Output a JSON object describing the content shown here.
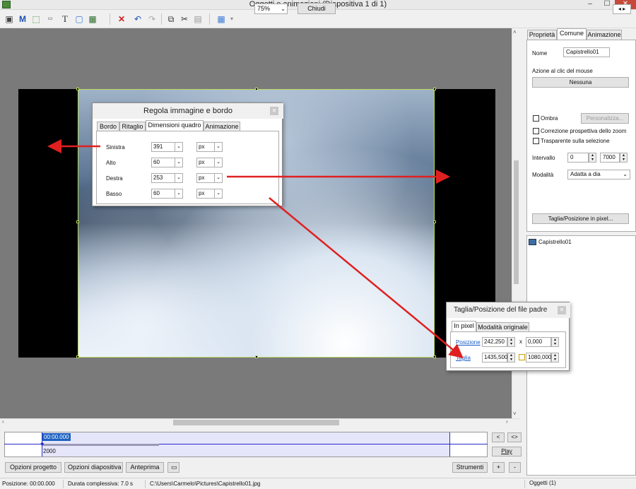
{
  "window": {
    "title": "Oggetti e animazioni  (Diapositiva 1 di 1)",
    "min": "–",
    "max": "☐",
    "close": "✕"
  },
  "toolbar": {
    "zoom": "75%",
    "close_label": "Chiudi",
    "text_tool": "T",
    "m_tool": "M"
  },
  "timeline": {
    "time": "00:00.000",
    "frame": "2000",
    "nav_left": "<",
    "nav_both": "<>",
    "play": "Play",
    "plus": "+",
    "minus": "-"
  },
  "bottom_buttons": {
    "project_options": "Opzioni progetto",
    "slide_options": "Opzioni diapositiva",
    "preview": "Anteprima",
    "tools": "Strumenti",
    "add": "+",
    "remove": "-"
  },
  "statusbar": {
    "position": "Posizione:  00:00.000",
    "duration": "Durata complessiva:  7.0 s",
    "path": "C:\\Users\\Carmelo\\Pictures\\Capistrello01.jpg",
    "objects": "Oggetti (1)"
  },
  "right_panel": {
    "tabs": [
      "Proprietà",
      "Comune",
      "Animazione"
    ],
    "name_label": "Nome",
    "name_value": "Capistrello01",
    "click_action_label": "Azione al clic del mouse",
    "click_action_value": "Nessuna",
    "shadow_label": "Ombra",
    "customize_label": "Personalizza...",
    "zoom_correction_label": "Correzione prospettiva dello zoom",
    "transparent_label": "Trasparente sulla selezione",
    "interval_label": "Intervallo",
    "interval_from": "0",
    "interval_to": "7000",
    "mode_label": "Modalità",
    "mode_value": "Adatta a dia",
    "crop_button": "Taglia/Posizione in pixel...",
    "object_item": "Capistrello01"
  },
  "dialog_crop": {
    "title": "Regola immagine e bordo",
    "tabs": [
      "Bordo",
      "Ritaglio",
      "Dimensioni quadro",
      "Animazione"
    ],
    "rows": [
      {
        "label": "Sinistra",
        "value": "391",
        "unit": "px"
      },
      {
        "label": "Alto",
        "value": "60",
        "unit": "px"
      },
      {
        "label": "Destra",
        "value": "253",
        "unit": "px"
      },
      {
        "label": "Basso",
        "value": "60",
        "unit": "px"
      }
    ]
  },
  "dialog_position": {
    "title": "Taglia/Posizione del file padre",
    "tabs": [
      "In pixel",
      "Modalità originale"
    ],
    "position_label": "Posizione",
    "position_x": "242,250",
    "position_y": "0,000",
    "size_label": "Taglia",
    "size_w": "1435,500",
    "size_h": "1080,000",
    "x_sep": "x"
  },
  "colors": {
    "arrow": "#e02020",
    "timeline_band": "#e6e6fb",
    "timeline_line": "#2b2bc9",
    "link": "#1a5ec8"
  }
}
